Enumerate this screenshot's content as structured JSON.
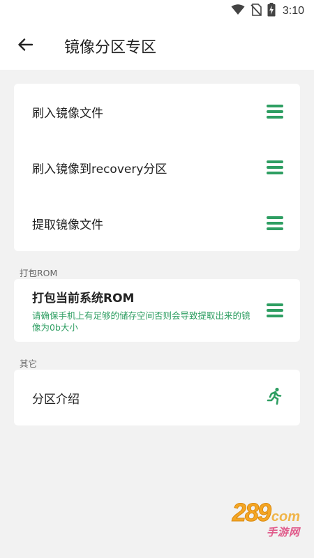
{
  "status_bar": {
    "time": "3:10",
    "icons": [
      "wifi-icon",
      "no-sim-icon",
      "battery-charging-icon"
    ]
  },
  "app_bar": {
    "back_icon": "arrow-left-icon",
    "title": "镜像分区专区"
  },
  "image_card": {
    "items": [
      {
        "label": "刷入镜像文件",
        "icon": "menu-icon"
      },
      {
        "label": "刷入镜像到recovery分区",
        "icon": "menu-icon"
      },
      {
        "label": "提取镜像文件",
        "icon": "menu-icon"
      }
    ]
  },
  "rom_section": {
    "header": "打包ROM",
    "item": {
      "title": "打包当前系统ROM",
      "description": "请确保手机上有足够的储存空间否则会导致提取出来的镜像为0b大小",
      "icon": "menu-icon"
    }
  },
  "other_section": {
    "header": "其它",
    "item": {
      "label": "分区介绍",
      "icon": "running-person-icon"
    }
  },
  "watermark": {
    "logo_text": "289",
    "domain_text": "com",
    "subtitle": "手游网"
  },
  "colors": {
    "accent": "#2e9e62",
    "background": "#f2f2f2",
    "card": "#ffffff",
    "text": "#222222"
  }
}
